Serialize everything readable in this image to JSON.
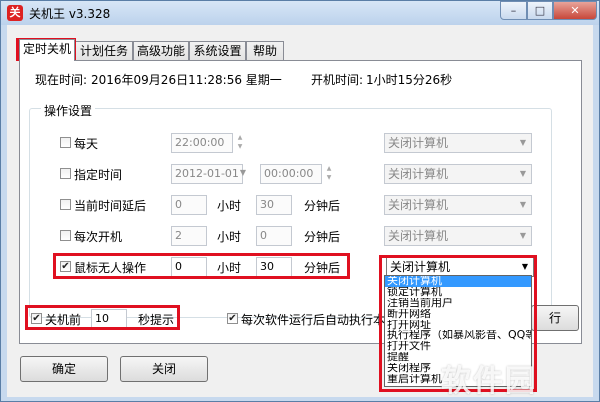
{
  "window": {
    "title": "关机王 v3.328",
    "icon_glyph": "关",
    "minimize_glyph": "–",
    "maximize_glyph": "□",
    "close_glyph": "✕"
  },
  "tabs": [
    {
      "label": "定时关机",
      "active": true
    },
    {
      "label": "计划任务"
    },
    {
      "label": "高级功能"
    },
    {
      "label": "系统设置"
    },
    {
      "label": "帮助"
    }
  ],
  "status": {
    "now_label": "现在时间:",
    "now_value": "2016年09月26日11:28:56  星期一",
    "uptime_label": "开机时间:",
    "uptime_value": "1小时15分26秒"
  },
  "operations": {
    "group_title": "操作设置",
    "every_day": {
      "label": "每天",
      "time": "22:00:00",
      "action": "关闭计算机"
    },
    "specified_time": {
      "label": "指定时间",
      "date": "2012-01-01",
      "time": "00:00:00",
      "action": "关闭计算机"
    },
    "delay_after_now": {
      "label": "当前时间延后",
      "hours": "0",
      "hours_unit": "小时",
      "minutes": "30",
      "minutes_unit": "分钟后",
      "action": "关闭计算机"
    },
    "every_boot": {
      "label": "每次开机",
      "hours": "2",
      "hours_unit": "小时",
      "minutes": "0",
      "minutes_unit": "分钟后",
      "action": "关闭计算机"
    },
    "mouse_idle": {
      "label": "鼠标无人操作",
      "checked": true,
      "hours": "0",
      "hours_unit": "小时",
      "minutes": "30",
      "minutes_unit": "分钟后",
      "action": "关闭计算机"
    }
  },
  "action_options": [
    "关闭计算机",
    "锁定计算机",
    "注销当前用户",
    "断开网络",
    "打开网址",
    "执行程序（如暴风影音、QQ等）",
    "打开文件",
    "提醒",
    "关闭程序",
    "重启计算机"
  ],
  "bottom": {
    "before_shutdown_label": "关机前",
    "before_shutdown_seconds": "10",
    "before_shutdown_suffix": "秒提示",
    "auto_exec_label": "每次软件运行后自动执行本页",
    "partial_button_label": "行",
    "ok_label": "确定",
    "close_label": "关闭"
  },
  "watermark": "软件园"
}
